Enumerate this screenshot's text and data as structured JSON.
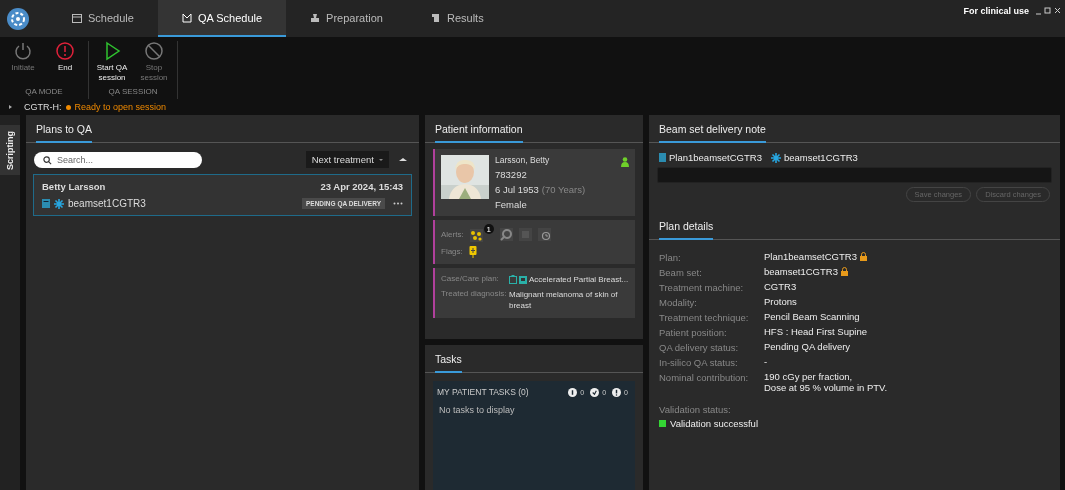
{
  "tabs": [
    {
      "kind": "calendar",
      "label": "Schedule",
      "selected": false
    },
    {
      "kind": "qa",
      "label": "QA Schedule",
      "selected": true
    },
    {
      "kind": "prep",
      "label": "Preparation",
      "selected": false
    },
    {
      "kind": "results",
      "label": "Results",
      "selected": false
    }
  ],
  "clinical_badge": "For clinical use",
  "ribbon": [
    {
      "label": "QA MODE",
      "buttons": [
        {
          "kind": "power",
          "label": "Initiate",
          "disabled": true
        },
        {
          "kind": "end",
          "label": "End",
          "disabled": false
        }
      ]
    },
    {
      "label": "QA SESSION",
      "buttons": [
        {
          "kind": "play",
          "label": "Start QA session",
          "disabled": false
        },
        {
          "kind": "stop",
          "label": "Stop session",
          "disabled": true
        }
      ]
    }
  ],
  "status": {
    "machine": "CGTR-H:",
    "message": "Ready to open session"
  },
  "side_tab": "Scripting",
  "plans": {
    "title": "Plans to QA",
    "search": {
      "placeholder": "Search..."
    },
    "sort": "Next treatment",
    "items": [
      {
        "patient": "Betty Larsson",
        "date": "23 Apr 2024, 15:43",
        "beam_set": "beamset1CGTR3",
        "status": "PENDING QA DELIVERY",
        "selected": true
      }
    ]
  },
  "patient": {
    "title": "Patient information",
    "name": "Larsson, Betty",
    "id": "783292",
    "dob": "6 Jul 1953",
    "age": "(70 Years)",
    "sex": "Female",
    "alerts_label": "Alerts:",
    "alerts": [
      {
        "kind": "allergy",
        "count": "1"
      },
      {
        "kind": "infection"
      },
      {
        "kind": "implant"
      },
      {
        "kind": "history"
      }
    ],
    "flags_label": "Flags:",
    "case_label": "Case/Care plan:",
    "case_value": "Accelerated Partial Breast...",
    "diagnosis_label": "Treated diagnosis:",
    "diagnosis_value": "Malignant melanoma of skin of breast"
  },
  "tasks": {
    "title": "Tasks",
    "header": "MY PATIENT TASKS (0)",
    "counts": [
      {
        "kind": "info",
        "value": "0"
      },
      {
        "kind": "done",
        "value": "0"
      },
      {
        "kind": "alert",
        "value": "0"
      }
    ],
    "empty": "No tasks to display"
  },
  "note": {
    "title": "Beam set delivery note",
    "plan": "Plan1beamsetCGTR3",
    "beam_set": "beamset1CGTR3",
    "buttons": [
      {
        "label": "Save changes",
        "disabled": true
      },
      {
        "label": "Discard changes",
        "disabled": true
      }
    ]
  },
  "details": {
    "title": "Plan details",
    "rows": [
      {
        "label": "Plan:",
        "value": "Plan1beamsetCGTR3",
        "locked": true
      },
      {
        "label": "Beam set:",
        "value": "beamset1CGTR3",
        "locked": true
      },
      {
        "label": "Treatment machine:",
        "value": "CGTR3",
        "locked": false
      },
      {
        "label": "Modality:",
        "value": "Protons",
        "locked": false
      },
      {
        "label": "Treatment technique:",
        "value": "Pencil Beam Scanning",
        "locked": false
      },
      {
        "label": "Patient position:",
        "value": "HFS : Head First Supine",
        "locked": false
      },
      {
        "label": "QA delivery status:",
        "value": "Pending QA delivery",
        "locked": false
      },
      {
        "label": "In-silico QA status:",
        "value": "-",
        "locked": false
      },
      {
        "label": "Nominal contribution:",
        "value": "190 cGy per fraction,\nDose at 95 % volume in PTV.",
        "locked": false
      }
    ],
    "validation_label": "Validation status:",
    "validation": "Validation successful",
    "validation_passed": true
  }
}
